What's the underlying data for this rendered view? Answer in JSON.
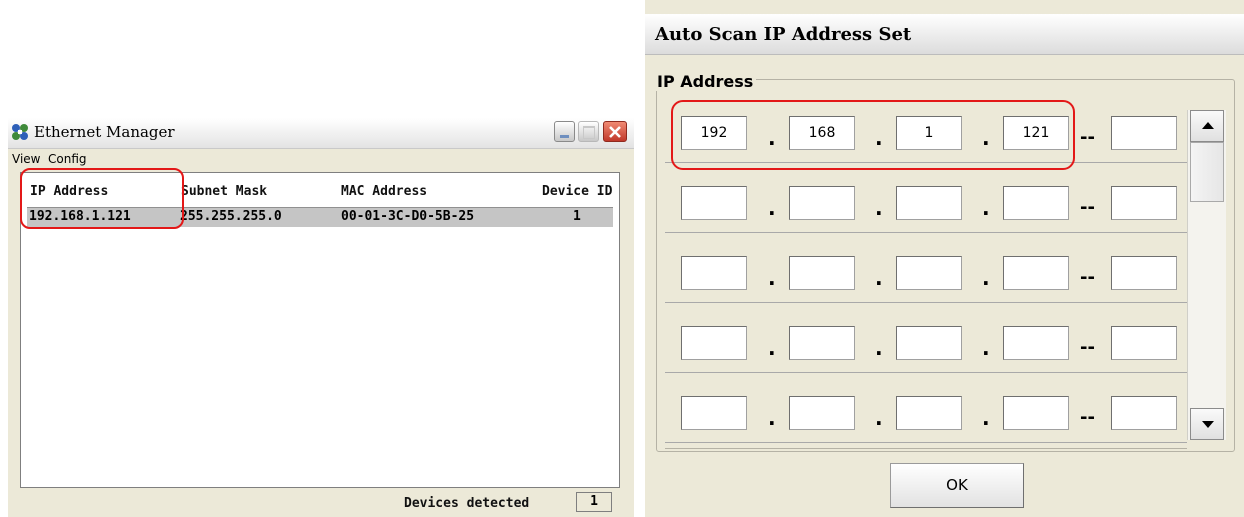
{
  "ethernet_manager": {
    "title": "Ethernet Manager",
    "menu": [
      "View",
      "Config"
    ],
    "columns": [
      "IP Address",
      "Subnet Mask",
      "MAC Address",
      "Device ID"
    ],
    "rows": [
      {
        "ip": "192.168.1.121",
        "subnet": "255.255.255.0",
        "mac": "00-01-3C-D0-5B-25",
        "device_id": "1"
      }
    ],
    "status_label": "Devices detected",
    "devices_detected": "1",
    "highlight_color": "#e31818"
  },
  "auto_scan": {
    "title": "Auto Scan IP Address Set",
    "group_label": "IP Address",
    "dot": ".",
    "dash": "--",
    "rows": [
      {
        "octets": [
          "192",
          "168",
          "1",
          "121"
        ],
        "range_end": ""
      },
      {
        "octets": [
          "",
          "",
          "",
          ""
        ],
        "range_end": ""
      },
      {
        "octets": [
          "",
          "",
          "",
          ""
        ],
        "range_end": ""
      },
      {
        "octets": [
          "",
          "",
          "",
          ""
        ],
        "range_end": ""
      },
      {
        "octets": [
          "",
          "",
          "",
          ""
        ],
        "range_end": ""
      }
    ],
    "ok_label": "OK",
    "highlight_color": "#e31818"
  }
}
